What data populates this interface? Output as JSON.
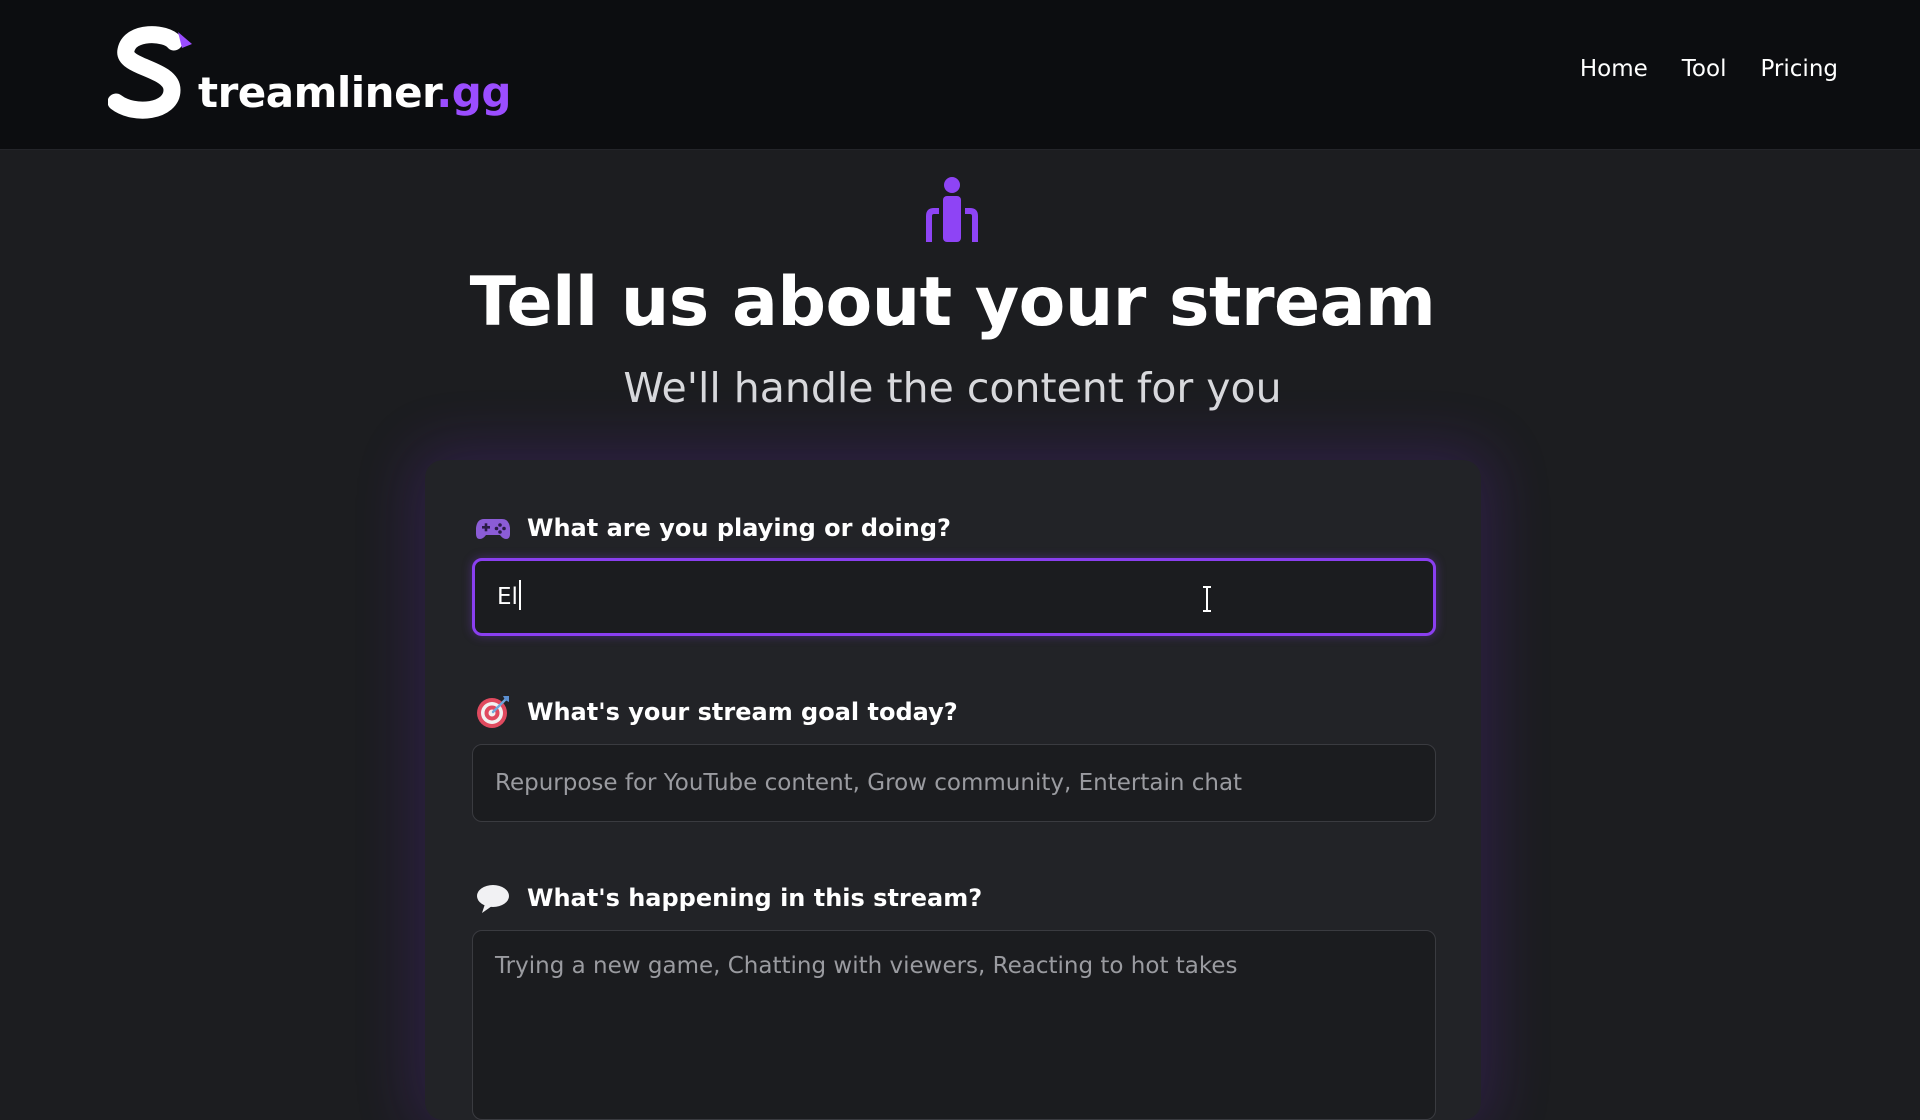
{
  "brand": {
    "logo_letter": "S",
    "name": "treamliner",
    "tld": ".gg",
    "accent_color": "#9b4dff"
  },
  "nav": {
    "items": [
      {
        "label": "Home"
      },
      {
        "label": "Tool"
      },
      {
        "label": "Pricing"
      }
    ]
  },
  "hero": {
    "icon": "community-icon",
    "title": "Tell us about your stream",
    "subtitle": "We'll handle the content for you"
  },
  "form": {
    "fields": [
      {
        "icon": "game-controller-icon",
        "label": "What are you playing or doing?",
        "value": "El",
        "placeholder": "",
        "focused": true
      },
      {
        "icon": "target-icon",
        "label": "What's your stream goal today?",
        "value": "",
        "placeholder": "Repurpose for YouTube content, Grow community, Entertain chat"
      },
      {
        "icon": "speech-bubble-icon",
        "label": "What's happening in this stream?",
        "value": "",
        "placeholder": "Trying a new game, Chatting with viewers, Reacting to hot takes"
      }
    ]
  },
  "colors": {
    "focus_border": "#8a3ff0",
    "background": "#1c1d20",
    "card": "#222327",
    "navbar": "#0c0d10"
  }
}
